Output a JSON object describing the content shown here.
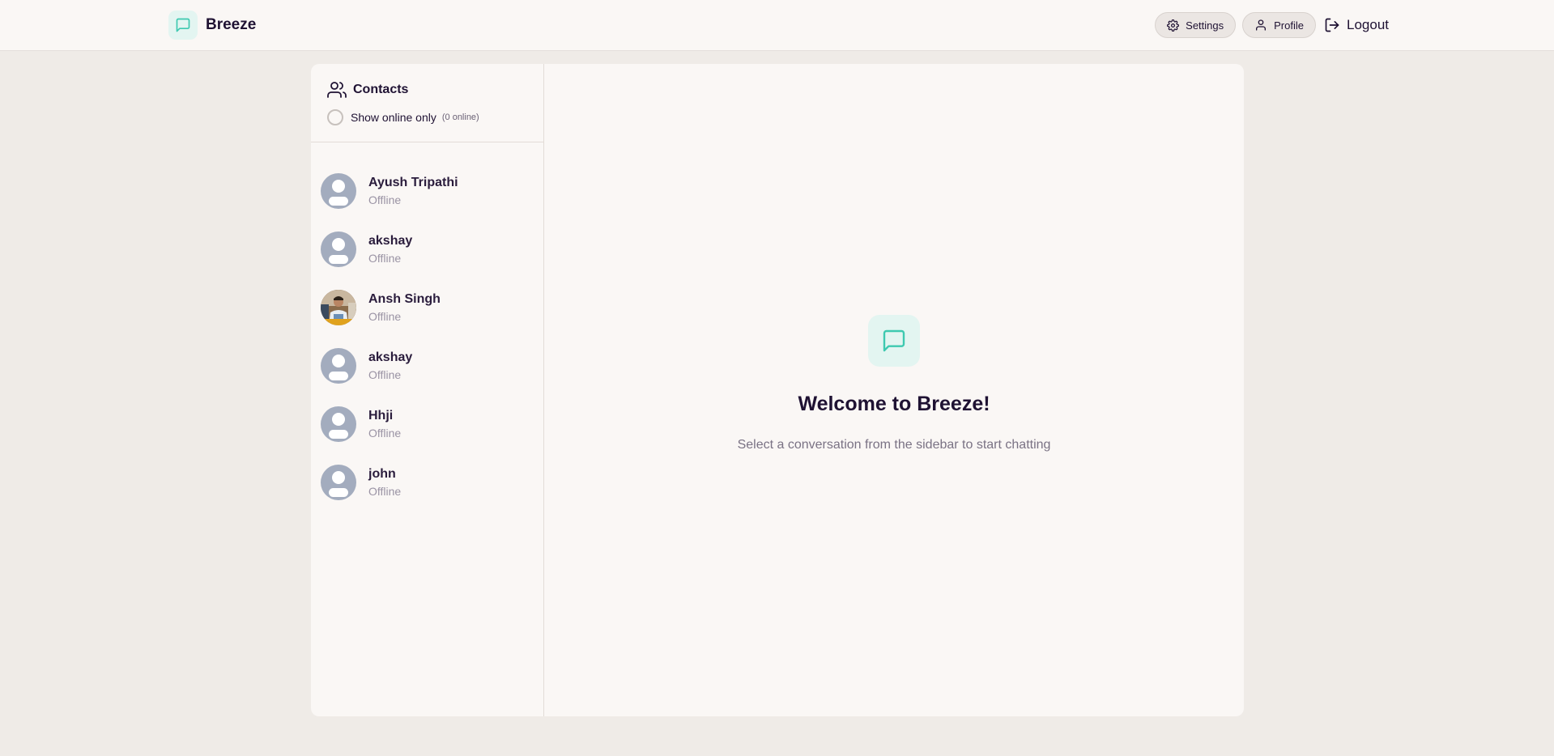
{
  "colors": {
    "accent": "#3ec9b0",
    "background": "#efebe7",
    "surface": "#faf7f5",
    "text": "#1f1233"
  },
  "header": {
    "brand_name": "Breeze",
    "brand_icon": "chat-bubble-icon",
    "settings_label": "Settings",
    "settings_icon": "gear-icon",
    "profile_label": "Profile",
    "profile_icon": "user-icon",
    "logout_label": "Logout",
    "logout_icon": "logout-icon"
  },
  "sidebar": {
    "title": "Contacts",
    "title_icon": "users-icon",
    "filter_label": "Show online only",
    "online_count": "(0 online)",
    "filter_checked": false,
    "contacts": [
      {
        "name": "Ayush Tripathi",
        "status": "Offline",
        "avatar": "default-avatar"
      },
      {
        "name": "akshay",
        "status": "Offline",
        "avatar": "default-avatar"
      },
      {
        "name": "Ansh Singh",
        "status": "Offline",
        "avatar": "photo-avatar"
      },
      {
        "name": "akshay",
        "status": "Offline",
        "avatar": "default-avatar"
      },
      {
        "name": "Hhji",
        "status": "Offline",
        "avatar": "default-avatar"
      },
      {
        "name": "john",
        "status": "Offline",
        "avatar": "default-avatar"
      }
    ]
  },
  "main": {
    "welcome_title": "Welcome to Breeze!",
    "welcome_subtitle": "Select a conversation from the sidebar to start chatting",
    "welcome_icon": "chat-bubble-icon"
  }
}
